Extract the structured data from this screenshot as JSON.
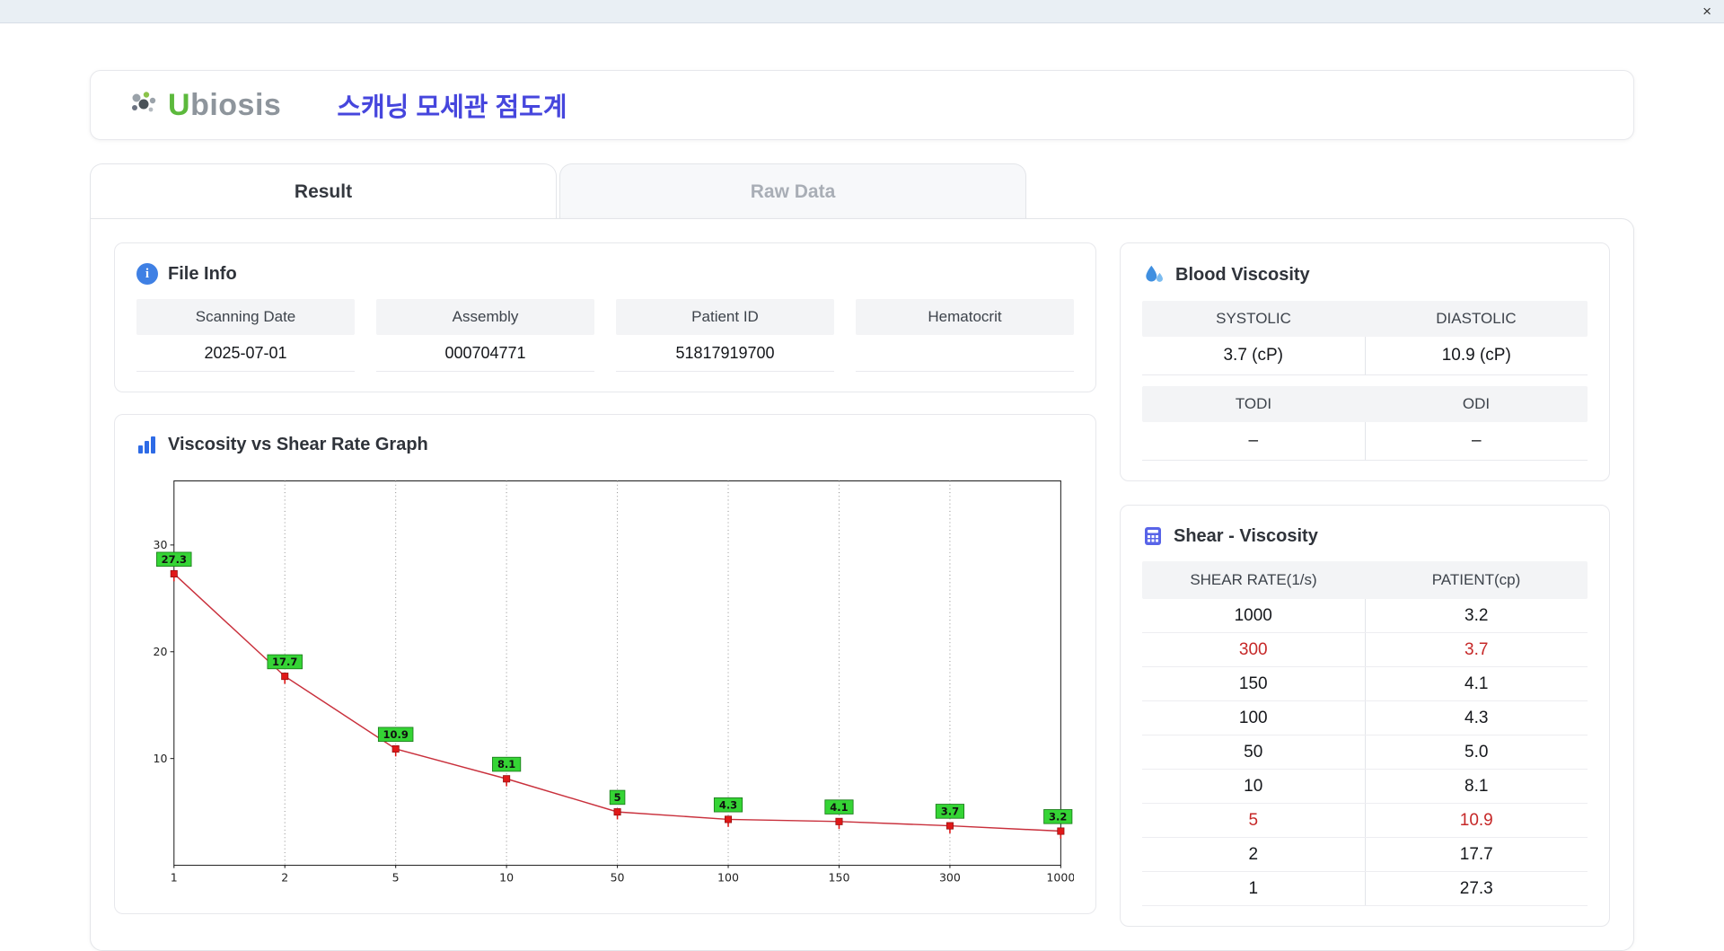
{
  "window": {
    "close_glyph": "×"
  },
  "header": {
    "logo_u": "U",
    "logo_rest": "biosis",
    "title": "스캐닝 모세관 점도계"
  },
  "tabs": [
    {
      "label": "Result",
      "active": true
    },
    {
      "label": "Raw Data",
      "active": false
    }
  ],
  "file_info": {
    "section_title": "File Info",
    "icon": "info-icon",
    "fields": [
      {
        "label": "Scanning Date",
        "value": "2025-07-01"
      },
      {
        "label": "Assembly",
        "value": "000704771"
      },
      {
        "label": "Patient ID",
        "value": "51817919700"
      },
      {
        "label": "Hematocrit",
        "value": ""
      }
    ]
  },
  "blood_viscosity": {
    "section_title": "Blood Viscosity",
    "icon": "droplet-icon",
    "groups": [
      {
        "cells": [
          {
            "label": "SYSTOLIC",
            "value": "3.7 (cP)"
          },
          {
            "label": "DIASTOLIC",
            "value": "10.9 (cP)"
          }
        ]
      },
      {
        "cells": [
          {
            "label": "TODI",
            "value": "–"
          },
          {
            "label": "ODI",
            "value": "–"
          }
        ]
      }
    ]
  },
  "graph": {
    "section_title": "Viscosity vs Shear Rate Graph",
    "icon": "bar-chart-icon"
  },
  "chart_data": {
    "type": "line",
    "title": "Viscosity vs Shear Rate Graph",
    "x_scale": "categorical-log",
    "x": [
      "1",
      "2",
      "5",
      "10",
      "50",
      "100",
      "150",
      "300",
      "1000"
    ],
    "values": [
      27.3,
      17.7,
      10.9,
      8.1,
      5,
      4.3,
      4.1,
      3.7,
      3.2
    ],
    "point_labels": [
      "27.3",
      "17.7",
      "10.9",
      "8.1",
      "5",
      "4.3",
      "4.1",
      "3.7",
      "3.2"
    ],
    "xlabel": "",
    "ylabel": "",
    "ylim": [
      0,
      36
    ],
    "yticks": [
      10,
      20,
      30
    ],
    "grid": "vertical-dotted",
    "legend": "none",
    "line_color": "#c9303c",
    "marker_color": "#e01818",
    "label_bg": "#35d435",
    "label_border": "#1a7a1a"
  },
  "shear_table": {
    "section_title": "Shear - Viscosity",
    "icon": "calculator-grid-icon",
    "columns": [
      "SHEAR RATE(1/s)",
      "PATIENT(cp)"
    ],
    "rows": [
      {
        "shear": "1000",
        "patient": "3.2",
        "highlight": false
      },
      {
        "shear": "300",
        "patient": "3.7",
        "highlight": true
      },
      {
        "shear": "150",
        "patient": "4.1",
        "highlight": false
      },
      {
        "shear": "100",
        "patient": "4.3",
        "highlight": false
      },
      {
        "shear": "50",
        "patient": "5.0",
        "highlight": false
      },
      {
        "shear": "10",
        "patient": "8.1",
        "highlight": false
      },
      {
        "shear": "5",
        "patient": "10.9",
        "highlight": true
      },
      {
        "shear": "2",
        "patient": "17.7",
        "highlight": false
      },
      {
        "shear": "1",
        "patient": "27.3",
        "highlight": false
      }
    ]
  },
  "colors": {
    "title_indigo": "#4646dd",
    "highlight_red": "#c62828",
    "icon_blue": "#3f80e4",
    "logo_green": "#5cb93c"
  }
}
